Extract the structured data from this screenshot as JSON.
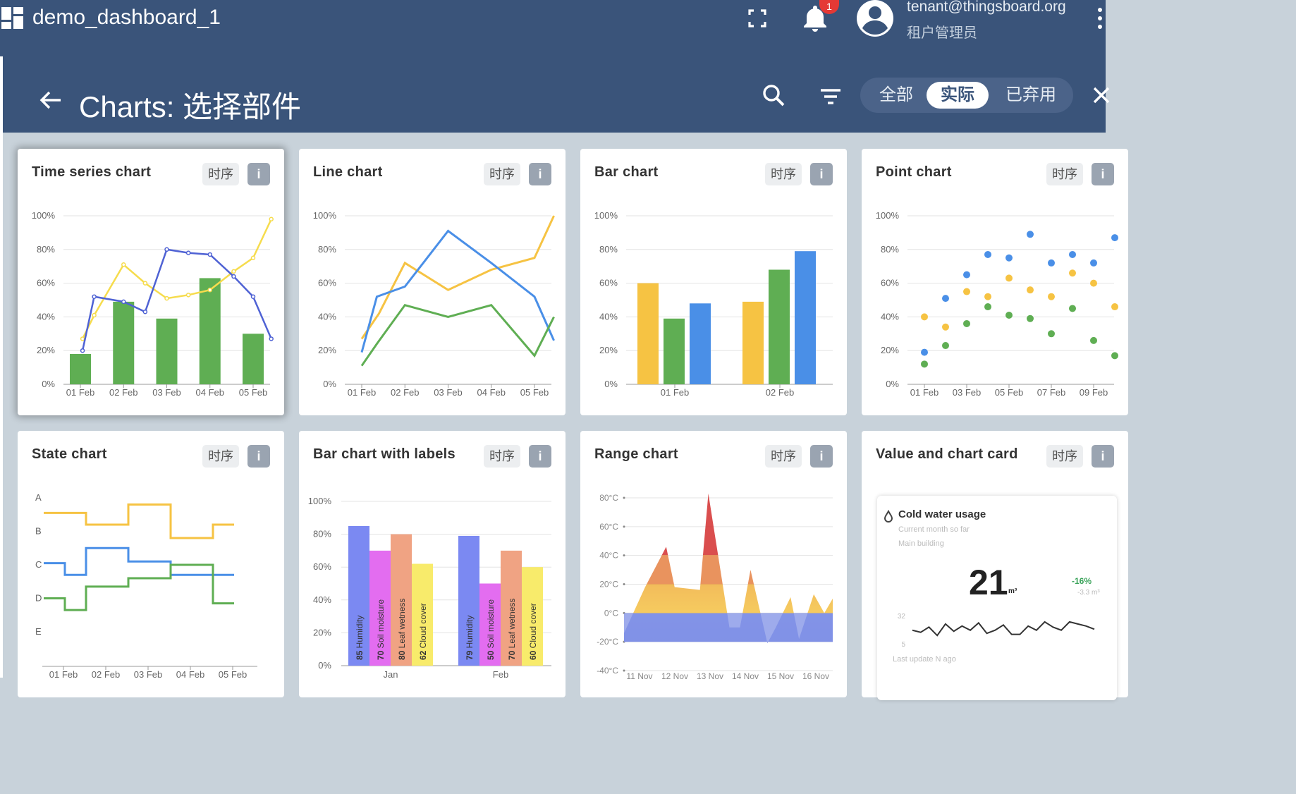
{
  "header": {
    "dashboard_title": "demo_dashboard_1",
    "notifications_count": "1",
    "user_email": "tenant@thingsboard.org",
    "user_role": "租户管理员"
  },
  "dialog": {
    "title": "Charts: 选择部件",
    "filters": {
      "all": "全部",
      "actual": "实际",
      "deprecated": "已弃用"
    },
    "selected_filter": "实际"
  },
  "colors": {
    "header_bg": "#3a547a",
    "yellow": "#f6c343",
    "green": "#5fae53",
    "blue": "#4a8fe7"
  },
  "cards": {
    "time_series": {
      "title": "Time series chart",
      "tag": "时序",
      "info": "i"
    },
    "line": {
      "title": "Line chart",
      "tag": "时序",
      "info": "i"
    },
    "bar": {
      "title": "Bar chart",
      "tag": "时序",
      "info": "i"
    },
    "point": {
      "title": "Point chart",
      "tag": "时序",
      "info": "i"
    },
    "state": {
      "title": "State chart",
      "tag": "时序",
      "info": "i"
    },
    "bar_labels": {
      "title": "Bar chart with labels",
      "tag": "时序",
      "info": "i"
    },
    "range": {
      "title": "Range chart",
      "tag": "时序",
      "info": "i"
    },
    "value_card": {
      "title": "Value and chart card",
      "tag": "时序",
      "info": "i",
      "inner_title": "Cold water usage",
      "subtitle1": "Current month so far",
      "subtitle2": "Main building",
      "value": "21",
      "unit": "m³",
      "delta": "-16%",
      "delta_sub": "-3.3 m³",
      "y_ticks": [
        "32",
        "5"
      ],
      "last_update": "Last update N ago",
      "chart_data": {
        "type": "line",
        "values": [
          18,
          16,
          21,
          13,
          24,
          17,
          22,
          18,
          25,
          15,
          18,
          23,
          14,
          14,
          22,
          18,
          26,
          21,
          18,
          26,
          24,
          22,
          19
        ]
      }
    }
  },
  "chart_data": [
    {
      "id": "time_series",
      "type": "bar",
      "categories": [
        "01 Feb",
        "02 Feb",
        "03 Feb",
        "04 Feb",
        "05 Feb"
      ],
      "y_ticks": [
        "0%",
        "20%",
        "40%",
        "60%",
        "80%",
        "100%"
      ],
      "ylim": [
        0,
        100
      ],
      "bars": [
        18,
        49,
        39,
        63,
        30
      ],
      "lines": [
        {
          "color": "yellow",
          "x": [
            0.05,
            0.32,
            1,
            1.5,
            2,
            2.5,
            3,
            3.55,
            4,
            4.42
          ],
          "y": [
            27,
            41,
            71,
            60,
            51,
            53,
            56,
            67,
            75,
            98
          ]
        },
        {
          "color": "blue",
          "x": [
            0.05,
            0.32,
            1,
            1.5,
            2,
            2.5,
            3,
            3.55,
            4,
            4.42
          ],
          "y": [
            20,
            52,
            49,
            43,
            80,
            78,
            77,
            64,
            52,
            27
          ]
        }
      ]
    },
    {
      "id": "line",
      "type": "line",
      "categories": [
        "01 Feb",
        "02 Feb",
        "03 Feb",
        "04 Feb",
        "05 Feb"
      ],
      "y_ticks": [
        "0%",
        "20%",
        "40%",
        "60%",
        "80%",
        "100%"
      ],
      "ylim": [
        0,
        100
      ],
      "series": [
        {
          "color": "yellow",
          "x": [
            0,
            0.4,
            1,
            2,
            3,
            4,
            4.45
          ],
          "y": [
            27,
            42,
            72,
            56,
            68,
            75,
            100
          ]
        },
        {
          "color": "blue",
          "x": [
            0,
            0.35,
            1,
            2,
            3,
            4,
            4.45
          ],
          "y": [
            19,
            52,
            58,
            91,
            72,
            52,
            26
          ]
        },
        {
          "color": "green",
          "x": [
            0,
            0.35,
            1,
            2,
            3,
            4,
            4.45
          ],
          "y": [
            11,
            24,
            47,
            40,
            47,
            17,
            40
          ]
        }
      ]
    },
    {
      "id": "bar",
      "type": "bar",
      "categories": [
        "01 Feb",
        "02 Feb"
      ],
      "y_ticks": [
        "0%",
        "20%",
        "40%",
        "60%",
        "80%",
        "100%"
      ],
      "ylim": [
        0,
        100
      ],
      "series": [
        {
          "color": "yellow",
          "values": [
            60,
            49
          ]
        },
        {
          "color": "green",
          "values": [
            39,
            68
          ]
        },
        {
          "color": "blue",
          "values": [
            48,
            79
          ]
        }
      ]
    },
    {
      "id": "point",
      "type": "scatter",
      "categories": [
        "01 Feb",
        "03 Feb",
        "05 Feb",
        "07 Feb",
        "09 Feb"
      ],
      "y_ticks": [
        "0%",
        "20%",
        "40%",
        "60%",
        "80%",
        "100%"
      ],
      "ylim": [
        0,
        100
      ],
      "series": [
        {
          "color": "blue",
          "x": [
            0,
            0.5,
            1,
            1.5,
            2,
            2.5,
            3,
            3.5,
            4,
            4.5
          ],
          "y": [
            19,
            51,
            65,
            77,
            75,
            89,
            72,
            77,
            72,
            87
          ]
        },
        {
          "color": "yellow",
          "x": [
            0,
            0.5,
            1,
            1.5,
            2,
            2.5,
            3,
            3.5,
            4,
            4.5
          ],
          "y": [
            40,
            34,
            55,
            52,
            63,
            56,
            52,
            66,
            60,
            46
          ]
        },
        {
          "color": "green",
          "x": [
            0,
            0.5,
            1,
            1.5,
            2,
            2.5,
            3,
            3.5,
            4,
            4.5
          ],
          "y": [
            12,
            23,
            36,
            46,
            41,
            39,
            30,
            45,
            26,
            17
          ]
        }
      ]
    },
    {
      "id": "state",
      "type": "line",
      "categories": [
        "01 Feb",
        "02 Feb",
        "03 Feb",
        "04 Feb",
        "05 Feb"
      ],
      "states": [
        "A",
        "B",
        "C",
        "D",
        "E"
      ],
      "series": [
        {
          "color": "yellow",
          "x": [
            0,
            1,
            1,
            2,
            2,
            3,
            3,
            4,
            4,
            4.5
          ],
          "y": [
            1.45,
            1.45,
            1.8,
            1.8,
            1.2,
            1.2,
            2.2,
            2.2,
            1.8,
            1.8
          ]
        },
        {
          "color": "blue",
          "x": [
            0,
            0.5,
            0.5,
            1,
            1,
            2,
            2,
            3,
            3,
            4.5
          ],
          "y": [
            2.95,
            2.95,
            3.3,
            3.3,
            2.5,
            2.5,
            2.9,
            2.9,
            3.3,
            3.3
          ]
        },
        {
          "color": "green",
          "x": [
            0,
            0.5,
            0.5,
            1,
            1,
            2,
            2,
            3,
            3,
            4,
            4,
            4.5
          ],
          "y": [
            4.0,
            4.0,
            4.35,
            4.35,
            3.65,
            3.65,
            3.4,
            3.4,
            3.0,
            3.0,
            4.15,
            4.15
          ]
        }
      ]
    },
    {
      "id": "bar_labels",
      "type": "bar",
      "categories": [
        "Jan",
        "Feb"
      ],
      "y_ticks": [
        "0%",
        "20%",
        "40%",
        "60%",
        "80%",
        "100%"
      ],
      "ylim": [
        0,
        100
      ],
      "series": [
        {
          "name": "Humidity",
          "color": "#7b89f2",
          "values": [
            85,
            79
          ]
        },
        {
          "name": "Soil moisture",
          "color": "#e36df0",
          "values": [
            70,
            50
          ]
        },
        {
          "name": "Leaf wetness",
          "color": "#f0a383",
          "values": [
            80,
            70
          ]
        },
        {
          "name": "Cloud cover",
          "color": "#f8eb6b",
          "values": [
            62,
            60
          ]
        }
      ]
    },
    {
      "id": "range",
      "type": "area",
      "categories": [
        "11 Nov",
        "12 Nov",
        "13 Nov",
        "14 Nov",
        "15 Nov",
        "16 Nov"
      ],
      "y_ticks": [
        "-40°C",
        "-20°C",
        "0°C",
        "20°C",
        "40°C",
        "60°C",
        "80°C"
      ],
      "ylim": [
        -40,
        80
      ],
      "x": [
        0,
        0.5,
        1.0,
        1.2,
        1.8,
        2.0,
        2.5,
        2.75,
        3.0,
        3.4,
        3.6,
        3.95,
        4.15,
        4.5,
        4.75,
        4.95
      ],
      "values": [
        -14,
        18,
        46,
        18,
        16,
        83,
        -10,
        -10,
        30,
        -21,
        -10,
        11,
        -18,
        13,
        0,
        10
      ]
    }
  ]
}
